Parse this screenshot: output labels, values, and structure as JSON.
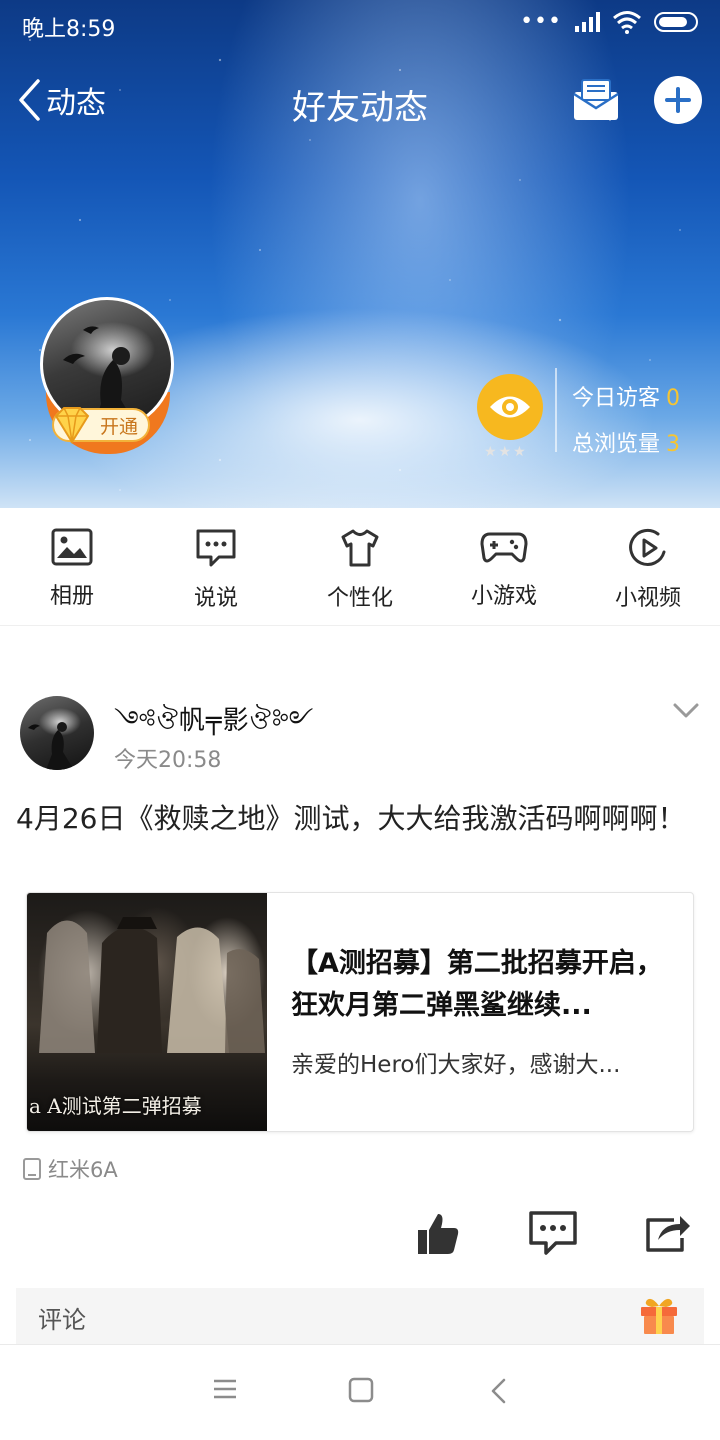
{
  "status_bar": {
    "time": "晚上8:59",
    "signal_dots": "•••"
  },
  "nav": {
    "back_label": "动态",
    "title": "好友动态"
  },
  "profile": {
    "vip_badge": "开通"
  },
  "visits": {
    "today_label": "今日访客",
    "today_value": "0",
    "total_label": "总浏览量",
    "total_value": "3",
    "stars": "★★★"
  },
  "quick_menu": [
    {
      "label": "相册",
      "icon": "photo-album-icon"
    },
    {
      "label": "说说",
      "icon": "chat-bubble-icon"
    },
    {
      "label": "个性化",
      "icon": "tshirt-icon"
    },
    {
      "label": "小游戏",
      "icon": "gamepad-icon"
    },
    {
      "label": "小视频",
      "icon": "play-video-icon"
    }
  ],
  "post": {
    "author": "༺ঔ帆╤影ঔ༻",
    "time": "今天20:58",
    "text": "4月26日《救赎之地》测试，大大给我激活码啊啊啊！",
    "card": {
      "thumb_caption": "a A测试第二弹招募",
      "title": "【A测招募】第二批招募开启，狂欢月第二弹黑鲨继续...",
      "desc": "亲爱的Hero们大家好，感谢大..."
    },
    "device": "红米6A"
  },
  "comment": {
    "label": "评论"
  },
  "colors": {
    "accent_orange": "#f0781e",
    "eye_yellow": "#f7b81f",
    "stat_number": "#f7c531"
  }
}
